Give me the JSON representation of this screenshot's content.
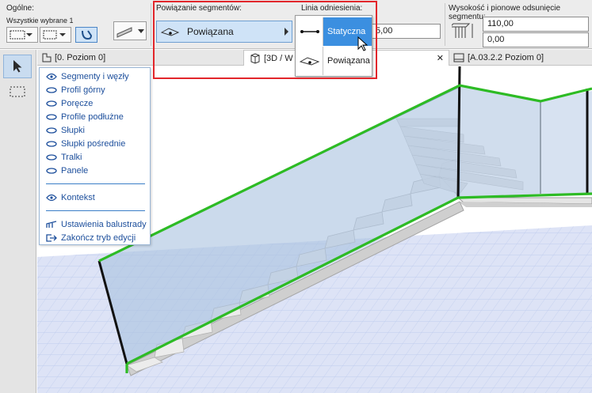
{
  "infobox": {
    "general": {
      "title": "Ogólne:",
      "selection_label": "Wszystkie wybrane 1"
    },
    "segment_linkage": {
      "title": "Powiązanie segmentów:",
      "value": "Powiązana"
    },
    "reference_line": {
      "title": "Linia odniesienia:",
      "partial_value": "5,00",
      "options": [
        {
          "label": "Statyczna",
          "selected": true
        },
        {
          "label": "Powiązana",
          "selected": false
        }
      ]
    },
    "height_offset": {
      "title": "Wysokość i pionowe odsunięcie segmentu:",
      "height": "110,00",
      "offset": "0,00"
    }
  },
  "tabs": [
    {
      "label": "[0. Poziom 0]",
      "icon": "floor-plan-icon"
    },
    {
      "label": "[3D / W",
      "icon": "3d-cube-icon"
    },
    {
      "label": "[A.03.2.2 Poziom 0]",
      "icon": "layout-icon"
    }
  ],
  "close_glyph": "✕",
  "menu": {
    "items": [
      "Segmenty i węzły",
      "Profil górny",
      "Poręcze",
      "Profile podłużne",
      "Słupki",
      "Słupki pośrednie",
      "Tralki",
      "Panele"
    ],
    "context": "Kontekst",
    "settings": "Ustawienia balustrady",
    "exit": "Zakończ tryb edycji"
  },
  "colors": {
    "accent_blue": "#3b8fe0",
    "highlight_red": "#e2262b",
    "railing_green": "#2dbb24",
    "menu_text": "#1d4f9c"
  }
}
